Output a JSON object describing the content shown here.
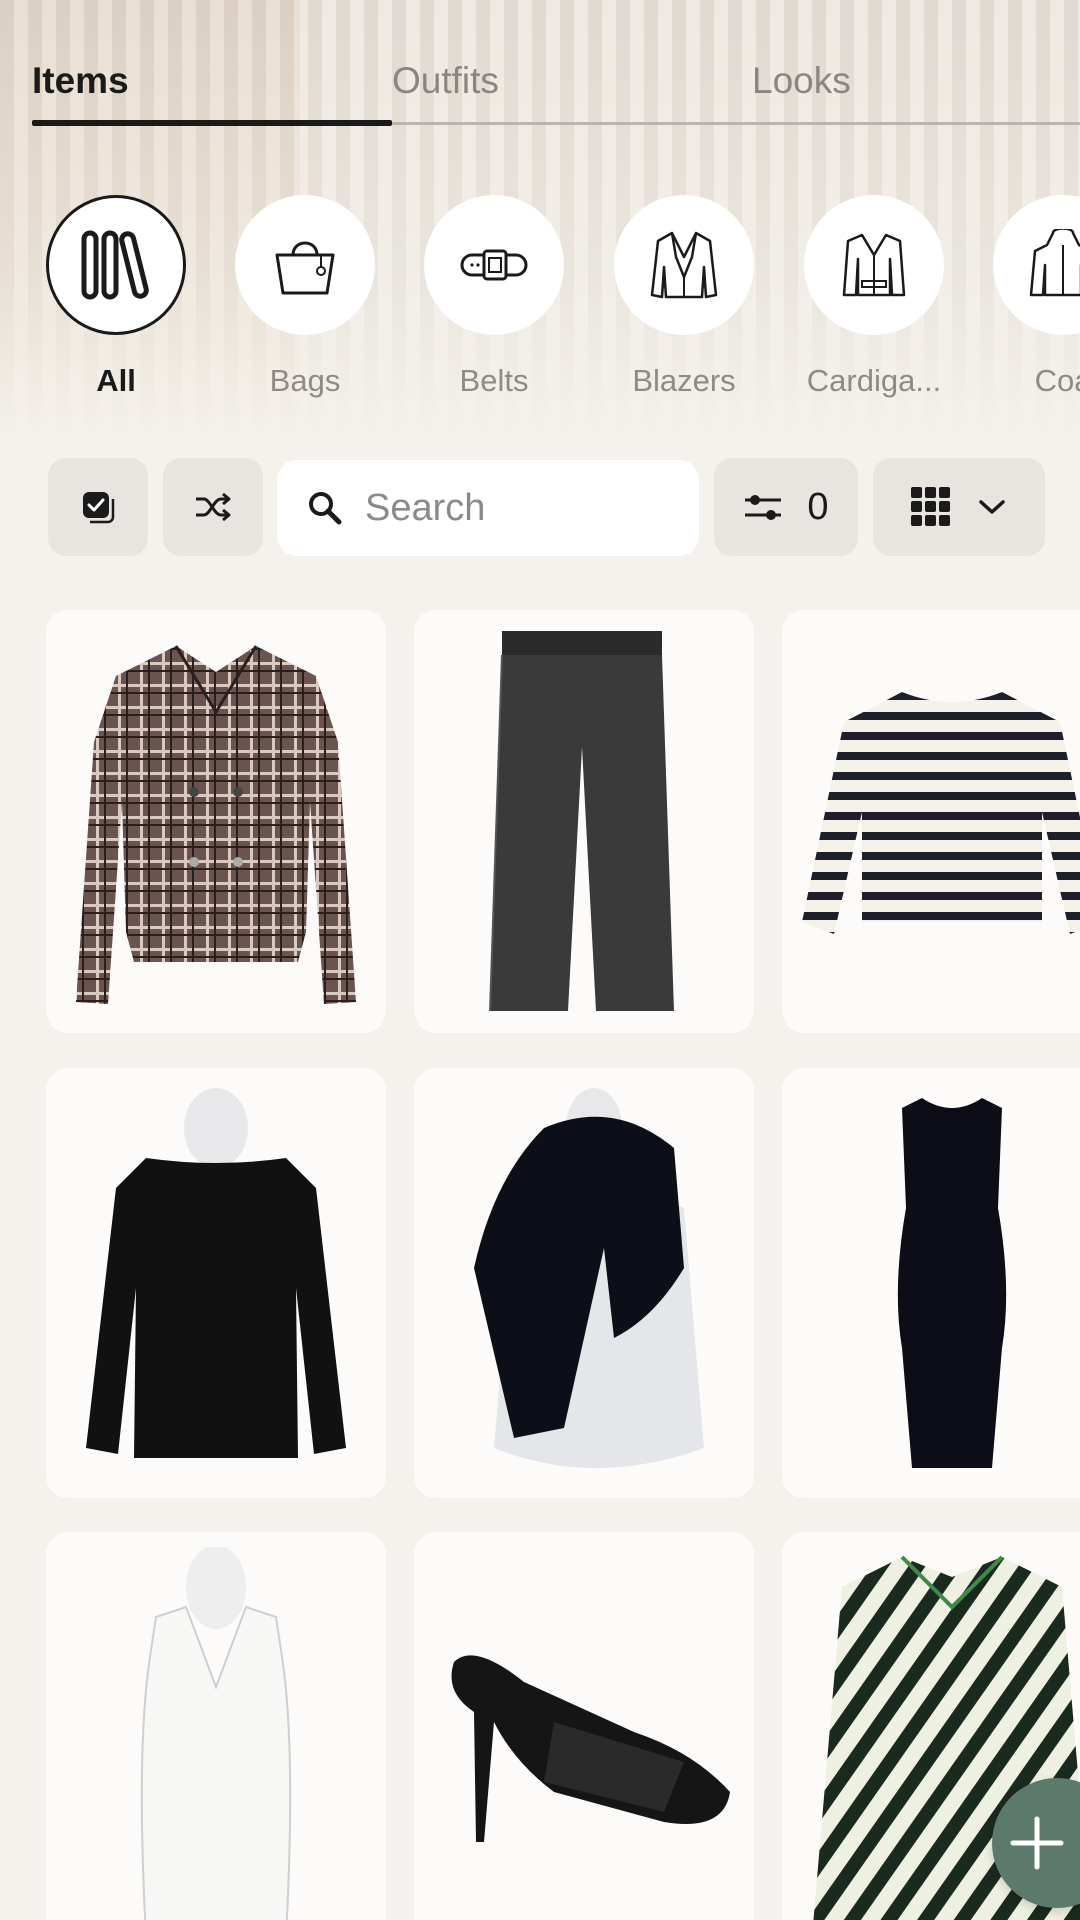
{
  "tabs": [
    {
      "label": "Items",
      "active": true
    },
    {
      "label": "Outfits",
      "active": false
    },
    {
      "label": "Looks",
      "active": false
    }
  ],
  "categories": [
    {
      "label": "All",
      "icon": "all-items-icon",
      "active": true
    },
    {
      "label": "Bags",
      "icon": "bag-icon",
      "active": false
    },
    {
      "label": "Belts",
      "icon": "belt-icon",
      "active": false
    },
    {
      "label": "Blazers",
      "icon": "blazer-icon",
      "active": false
    },
    {
      "label": "Cardiga...",
      "icon": "cardigan-icon",
      "active": false
    },
    {
      "label": "Coa",
      "icon": "coat-icon",
      "active": false
    }
  ],
  "toolbar": {
    "select_icon": "checkbox-icon",
    "shuffle_icon": "shuffle-icon",
    "search_placeholder": "Search",
    "filter_count": "0",
    "view_icon": "grid-view-icon"
  },
  "items": [
    {
      "name": "plaid-double-breasted-jacket"
    },
    {
      "name": "dark-wide-leg-trousers"
    },
    {
      "name": "striped-long-sleeve-top"
    },
    {
      "name": "black-long-sleeve-top"
    },
    {
      "name": "black-scarf"
    },
    {
      "name": "black-sleeveless-dress"
    },
    {
      "name": "white-v-neck-tank"
    },
    {
      "name": "black-woven-heeled-sandal"
    },
    {
      "name": "striped-oversized-shirt"
    }
  ],
  "colors": {
    "background": "#f5f1ec",
    "card": "#fcfbf9",
    "fab": "#5b7a6c",
    "active_text": "#1a1a1a",
    "inactive_text": "#8a8580"
  }
}
